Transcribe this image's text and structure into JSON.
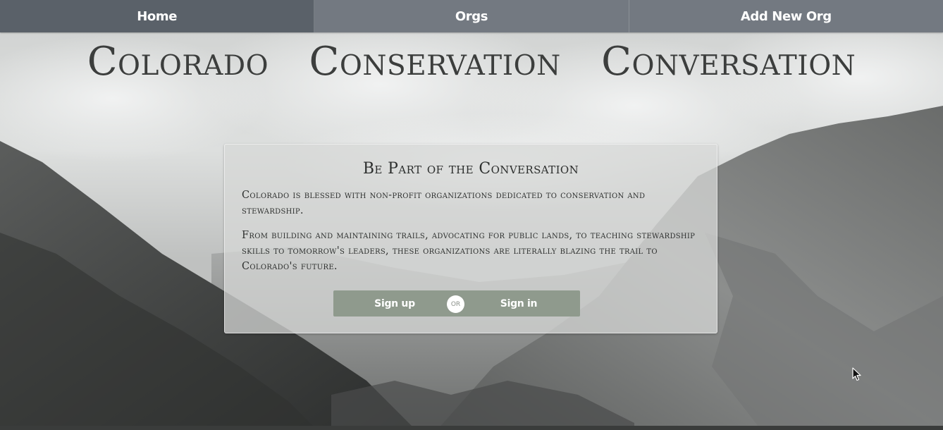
{
  "nav": {
    "items": [
      {
        "label": "Home",
        "active": true
      },
      {
        "label": "Orgs",
        "active": false
      },
      {
        "label": "Add New Org",
        "active": false
      }
    ]
  },
  "hero": {
    "words": [
      "Colorado",
      "Conservation",
      "Conversation"
    ]
  },
  "card": {
    "title": "Be Part of the Conversation",
    "paragraphs": [
      "Colorado is blessed with non-profit organizations dedicated to conservation and stewardship.",
      "From building and maintaining trails, advocating for public lands, to teaching stewardship skills to tomorrow's leaders, these organizations are literally blazing the trail to Colorado's future."
    ],
    "buttons": {
      "signup_label": "Sign up",
      "or_label": "OR",
      "signin_label": "Sign in"
    }
  },
  "colors": {
    "navbar": "#70767e",
    "button_group": "#8f9a8d",
    "title_text": "#3c3e3d"
  },
  "icons": {
    "cursor": "mouse-pointer-icon"
  }
}
